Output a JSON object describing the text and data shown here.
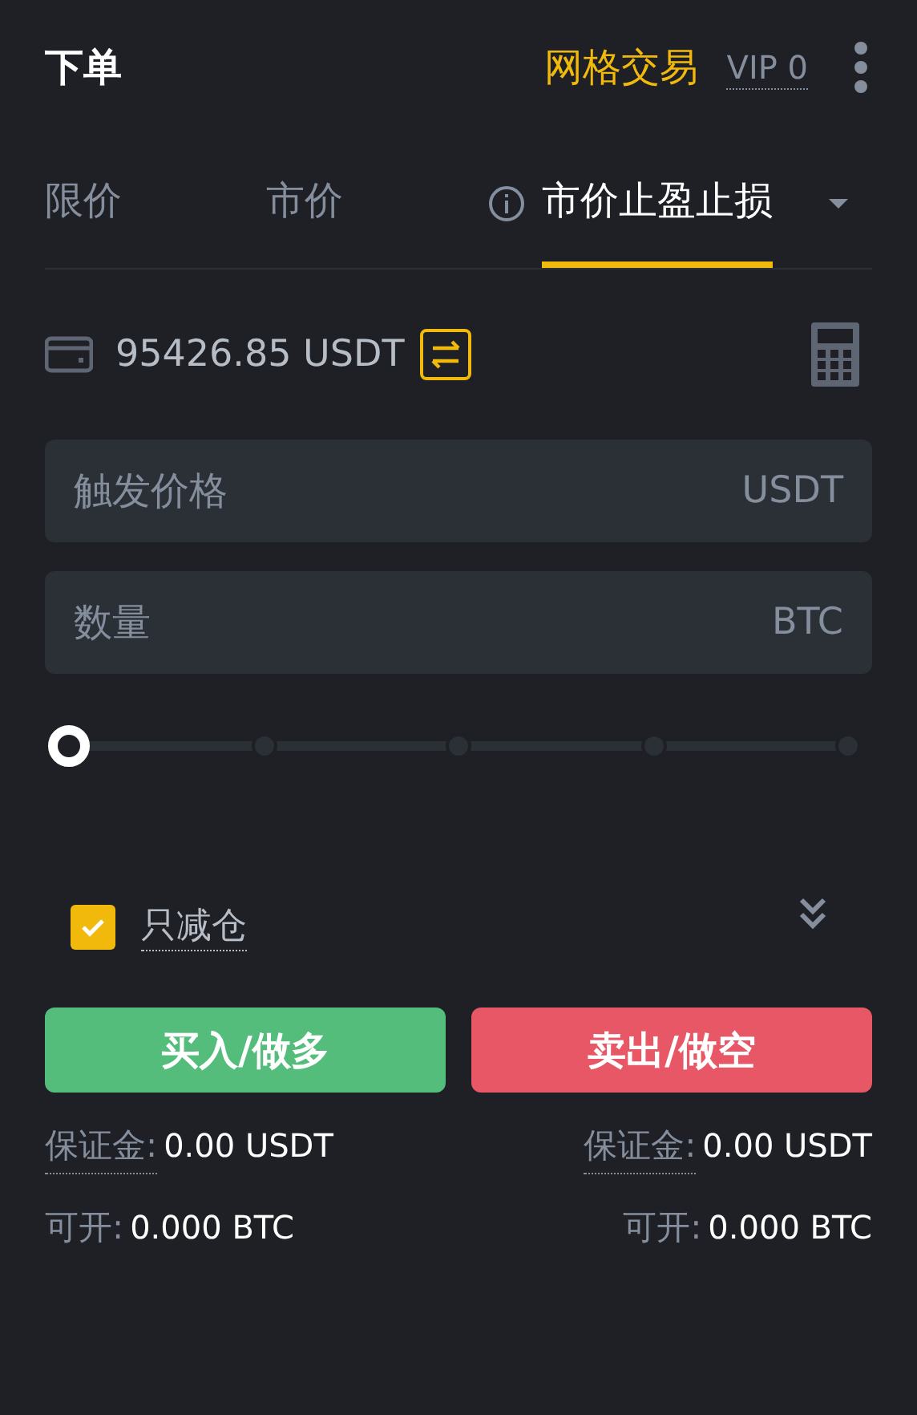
{
  "header": {
    "title": "下单",
    "grid_link": "网格交易",
    "vip": "VIP 0"
  },
  "tabs": [
    {
      "label": "限价",
      "selected": false,
      "info": false,
      "dropdown": false
    },
    {
      "label": "市价",
      "selected": false,
      "info": false,
      "dropdown": false
    },
    {
      "label": "市价止盈止损",
      "selected": true,
      "info": true,
      "dropdown": true
    }
  ],
  "balance": {
    "amount": "95426.85 USDT"
  },
  "fields": [
    {
      "placeholder": "触发价格",
      "unit": "USDT"
    },
    {
      "placeholder": "数量",
      "unit": "BTC"
    }
  ],
  "slider": {
    "level": 0
  },
  "reduce_only": {
    "label": "只减仓",
    "checked": true
  },
  "buttons": [
    {
      "label": "买入/做多",
      "kind": "buy"
    },
    {
      "label": "卖出/做空",
      "kind": "sell"
    }
  ],
  "stats": [
    {
      "margin_label": "保证金:",
      "margin": "0.00 USDT",
      "open_label": "可开:",
      "open": "0.000 BTC"
    },
    {
      "margin_label": "保证金:",
      "margin": "0.00 USDT",
      "open_label": "可开:",
      "open": "0.000 BTC"
    }
  ]
}
